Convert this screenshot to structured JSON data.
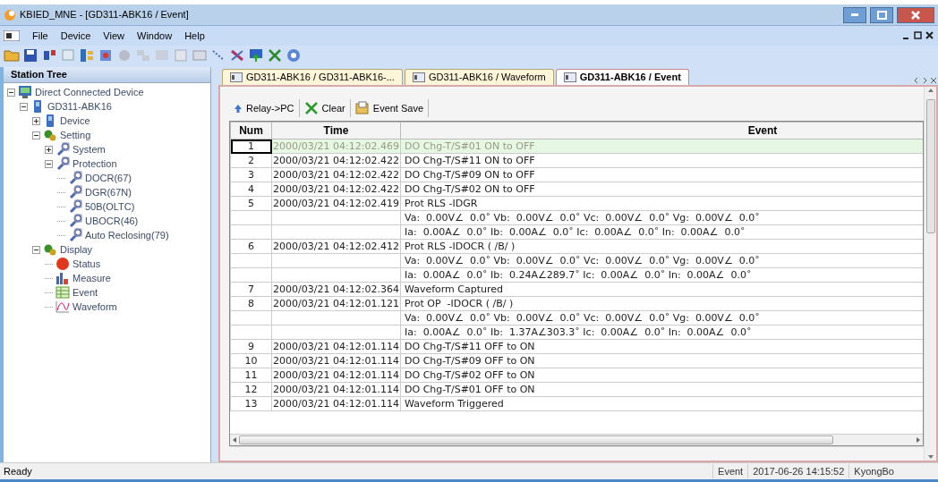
{
  "window": {
    "title": "KBIED_MNE - [GD311-ABK16 / Event]"
  },
  "menu": [
    "File",
    "Device",
    "View",
    "Window",
    "Help"
  ],
  "station_tree": {
    "title": "Station Tree",
    "items": [
      {
        "label": "Direct Connected Device",
        "kind": "station",
        "expanded": true,
        "children": [
          {
            "label": "GD311-ABK16",
            "kind": "device",
            "expanded": true,
            "children": [
              {
                "label": "Device",
                "kind": "device",
                "expanded": false
              },
              {
                "label": "Setting",
                "kind": "gears",
                "expanded": true,
                "children": [
                  {
                    "label": "System",
                    "kind": "wrench",
                    "expanded": false
                  },
                  {
                    "label": "Protection",
                    "kind": "wrench",
                    "expanded": true,
                    "children": [
                      {
                        "label": "DOCR(67)",
                        "kind": "wrench"
                      },
                      {
                        "label": "DGR(67N)",
                        "kind": "wrench"
                      },
                      {
                        "label": "50B(OLTC)",
                        "kind": "wrench"
                      },
                      {
                        "label": "UBOCR(46)",
                        "kind": "wrench"
                      },
                      {
                        "label": "Auto Reclosing(79)",
                        "kind": "wrench"
                      }
                    ]
                  }
                ]
              },
              {
                "label": "Display",
                "kind": "gears",
                "expanded": true,
                "children": [
                  {
                    "label": "Status",
                    "kind": "status"
                  },
                  {
                    "label": "Measure",
                    "kind": "measure"
                  },
                  {
                    "label": "Event",
                    "kind": "event"
                  },
                  {
                    "label": "Waveform",
                    "kind": "waveform"
                  }
                ]
              }
            ]
          }
        ]
      }
    ]
  },
  "tabs": [
    {
      "label": "GD311-ABK16 / GD311-ABK16-...",
      "selected": false
    },
    {
      "label": "GD311-ABK16 / Waveform",
      "selected": false
    },
    {
      "label": "GD311-ABK16 / Event",
      "selected": true
    }
  ],
  "event_toolbar": [
    {
      "label": "Relay->PC",
      "kind": "arrow"
    },
    {
      "label": "Clear",
      "kind": "cross"
    },
    {
      "label": "Event Save",
      "kind": "save"
    }
  ],
  "table": {
    "columns": [
      "Num",
      "Time",
      "Event"
    ],
    "rows": [
      {
        "num": "1",
        "time": "2000/03/21 04:12:02.469",
        "event": "DO Chg-T/S#01 ON to OFF",
        "selected": true
      },
      {
        "num": "2",
        "time": "2000/03/21 04:12:02.422",
        "event": "DO Chg-T/S#11 ON to OFF",
        "selected": false
      },
      {
        "num": "3",
        "time": "2000/03/21 04:12:02.422",
        "event": "DO Chg-T/S#09 ON to OFF",
        "selected": false
      },
      {
        "num": "4",
        "time": "2000/03/21 04:12:02.422",
        "event": "DO Chg-T/S#02 ON to OFF",
        "selected": false
      },
      {
        "num": "5",
        "time": "2000/03/21 04:12:02.419",
        "event": "Prot RLS -IDGR",
        "selected": false
      },
      {
        "event": "Va:  0.00V∠  0.0˚ Vb:  0.00V∠  0.0˚ Vc:  0.00V∠  0.0˚ Vg:  0.00V∠  0.0˚",
        "selected": false
      },
      {
        "event": "Ia:  0.00A∠  0.0˚ Ib:  0.00A∠  0.0˚ Ic:  0.00A∠  0.0˚ In:  0.00A∠  0.0˚",
        "selected": false
      },
      {
        "num": "6",
        "time": "2000/03/21 04:12:02.412",
        "event": "Prot RLS -IDOCR ( /B/ )",
        "selected": false
      },
      {
        "event": "Va:  0.00V∠  0.0˚ Vb:  0.00V∠  0.0˚ Vc:  0.00V∠  0.0˚ Vg:  0.00V∠  0.0˚",
        "selected": false
      },
      {
        "event": "Ia:  0.00A∠  0.0˚ Ib:  0.24A∠289.7˚ Ic:  0.00A∠  0.0˚ In:  0.00A∠  0.0˚",
        "selected": false
      },
      {
        "num": "7",
        "time": "2000/03/21 04:12:02.364",
        "event": "Waveform Captured",
        "selected": false
      },
      {
        "num": "8",
        "time": "2000/03/21 04:12:01.121",
        "event": "Prot OP  -IDOCR ( /B/ )",
        "selected": false
      },
      {
        "event": "Va:  0.00V∠  0.0˚ Vb:  0.00V∠  0.0˚ Vc:  0.00V∠  0.0˚ Vg:  0.00V∠  0.0˚",
        "selected": false
      },
      {
        "event": "Ia:  0.00A∠  0.0˚ Ib:  1.37A∠303.3˚ Ic:  0.00A∠  0.0˚ In:  0.00A∠  0.0˚",
        "selected": false
      },
      {
        "num": "9",
        "time": "2000/03/21 04:12:01.114",
        "event": "DO Chg-T/S#11 OFF to ON",
        "selected": false
      },
      {
        "num": "10",
        "time": "2000/03/21 04:12:01.114",
        "event": "DO Chg-T/S#09 OFF to ON",
        "selected": false
      },
      {
        "num": "11",
        "time": "2000/03/21 04:12:01.114",
        "event": "DO Chg-T/S#02 OFF to ON",
        "selected": false
      },
      {
        "num": "12",
        "time": "2000/03/21 04:12:01.114",
        "event": "DO Chg-T/S#01 OFF to ON",
        "selected": false
      },
      {
        "num": "13",
        "time": "2000/03/21 04:12:01.114",
        "event": "Waveform Triggered",
        "selected": false
      }
    ]
  },
  "status_bar": {
    "message": "Ready",
    "panels": [
      "Event",
      "2017-06-26 14:15:52",
      "KyongBo"
    ]
  }
}
